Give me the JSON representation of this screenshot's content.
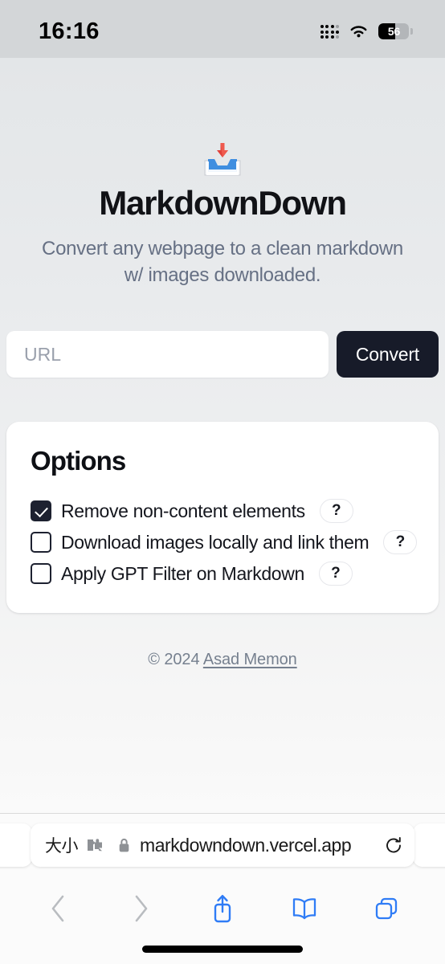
{
  "status_bar": {
    "time": "16:16",
    "signal_icon": "cellular-signal-icon",
    "wifi_icon": "wifi-icon",
    "battery_percent": "56",
    "battery_level": 56
  },
  "page": {
    "logo_icon": "inbox-tray-icon",
    "title": "MarkdownDown",
    "tagline": "Convert any webpage to a clean markdown w/ images downloaded.",
    "url_field": {
      "value": "",
      "placeholder": "URL"
    },
    "convert_label": "Convert",
    "options": {
      "heading": "Options",
      "help_label": "?",
      "items": [
        {
          "label": "Remove non-content elements",
          "checked": true
        },
        {
          "label": "Download images locally and link them",
          "checked": false
        },
        {
          "label": "Apply GPT Filter on Markdown",
          "checked": false
        }
      ]
    },
    "footer": {
      "copyright": "© 2024",
      "author": "Asad Memon"
    }
  },
  "browser": {
    "text_size_label": "大小",
    "extensions_icon": "puzzle-piece-icon",
    "lock_icon": "lock-icon",
    "url": "markdowndown.vercel.app",
    "reload_icon": "reload-icon",
    "toolbar": {
      "back_icon": "chevron-left-icon",
      "forward_icon": "chevron-right-icon",
      "share_icon": "share-icon",
      "bookmarks_icon": "book-icon",
      "tabs_icon": "tabs-icon"
    }
  },
  "colors": {
    "status_bg": "#d3d6d8",
    "accent_dark": "#171b29",
    "safari_blue": "#2f7cf6",
    "muted_text": "#667084"
  }
}
